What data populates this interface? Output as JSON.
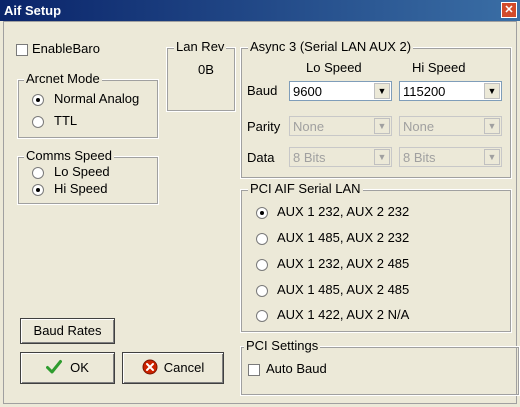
{
  "window": {
    "title": "Aif Setup",
    "close_glyph": "✕"
  },
  "enable_baro": {
    "label": "EnableBaro",
    "checked": false
  },
  "lan_rev": {
    "title": "Lan Rev",
    "value": "0B"
  },
  "arcnet_mode": {
    "title": "Arcnet Mode",
    "options": [
      {
        "label": "Normal Analog",
        "selected": true
      },
      {
        "label": "TTL",
        "selected": false
      }
    ]
  },
  "comms_speed": {
    "title": "Comms Speed",
    "options": [
      {
        "label": "Lo Speed",
        "selected": false
      },
      {
        "label": "Hi Speed",
        "selected": true
      }
    ]
  },
  "async3": {
    "title": "Async 3 (Serial LAN AUX 2)",
    "lo_header": "Lo Speed",
    "hi_header": "Hi Speed",
    "baud_label": "Baud",
    "parity_label": "Parity",
    "data_label": "Data",
    "baud_lo": "9600",
    "baud_hi": "115200",
    "parity_lo": "None",
    "parity_hi": "None",
    "data_lo": "8 Bits",
    "data_hi": "8 Bits"
  },
  "pci_aif": {
    "title": "PCI AIF Serial LAN",
    "options": [
      {
        "label": "AUX 1 232, AUX 2 232",
        "selected": true
      },
      {
        "label": "AUX 1 485, AUX 2 232",
        "selected": false
      },
      {
        "label": "AUX 1 232, AUX 2 485",
        "selected": false
      },
      {
        "label": "AUX 1 485, AUX 2 485",
        "selected": false
      },
      {
        "label": "AUX 1 422, AUX 2 N/A",
        "selected": false
      }
    ]
  },
  "pci_settings": {
    "title": "PCI Settings",
    "auto_baud_label": "Auto Baud",
    "auto_baud_checked": false
  },
  "buttons": {
    "baud_rates": "Baud Rates",
    "ok": "OK",
    "cancel": "Cancel"
  },
  "icons": {
    "ok_icon": "checkmark-icon",
    "cancel_icon": "cancel-icon",
    "ok_color": "#2e9c2e",
    "cancel_color": "#cc2200"
  }
}
